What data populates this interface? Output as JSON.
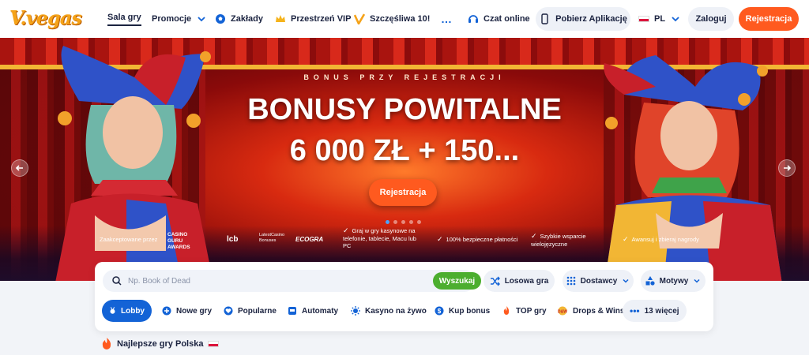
{
  "brand": {
    "logo_text": "V.vegas",
    "accent": "#ff5a1f",
    "blue": "#1363d6",
    "green": "#4cae2f"
  },
  "nav": {
    "items": [
      {
        "label": "Sala gry",
        "icon": ""
      },
      {
        "label": "Promocje",
        "icon": "chevron-down-icon"
      },
      {
        "label": "Zakłady",
        "icon": "soccer-ball-icon"
      },
      {
        "label": "Przestrzeń VIP",
        "icon": "crown-icon"
      },
      {
        "label": "Szczęśliwa 10!",
        "icon": "lucky-ten-icon"
      },
      {
        "label": "…",
        "icon": "more-dots-icon"
      },
      {
        "label": "Czat online",
        "icon": "headset-icon"
      }
    ],
    "download_app": "Pobierz Aplikację",
    "language": "PL",
    "login": "Zaloguj",
    "register": "Rejestracja"
  },
  "hero": {
    "subtitle": "BONUS PRZY REJESTRACJI",
    "title_line1": "BONUSY POWITALNE",
    "title_line2": "6 000 ZŁ + 150...",
    "button": "Rejestracja",
    "slides_total": 5,
    "slide_active": 1,
    "accepted_by": "Zaakceptowane przez",
    "partners": [
      "CASINO GURU AWARDS",
      "lcb",
      "LatestCasino Bonuses",
      "ECOGRA"
    ],
    "features": [
      "Graj w gry kasynowe na telefonie, tablecie, Macu lub PC",
      "100% bezpieczne płatności",
      "Szybkie wsparcie wielojęzyczne",
      "Awansuj i zbieraj nagrody"
    ]
  },
  "search": {
    "placeholder": "Np. Book of Dead",
    "button": "Wyszukaj",
    "random": "Losowa gra",
    "providers": "Dostawcy",
    "themes": "Motywy"
  },
  "categories": [
    {
      "label": "Lobby",
      "icon": "medal-icon"
    },
    {
      "label": "Nowe gry",
      "icon": "plus-circle-icon"
    },
    {
      "label": "Popularne",
      "icon": "heart-icon"
    },
    {
      "label": "Automaty",
      "icon": "slot-machine-icon"
    },
    {
      "label": "Kasyno na żywo",
      "icon": "live-casino-icon"
    },
    {
      "label": "Kup bonus",
      "icon": "dollar-coin-icon"
    },
    {
      "label": "TOP gry",
      "icon": "flame-icon"
    },
    {
      "label": "Drops & Wins",
      "icon": "drops-wins-icon"
    },
    {
      "label": "13 więcej",
      "icon": "more-dots-icon"
    }
  ],
  "section": {
    "title": "Najlepsze gry Polska"
  }
}
